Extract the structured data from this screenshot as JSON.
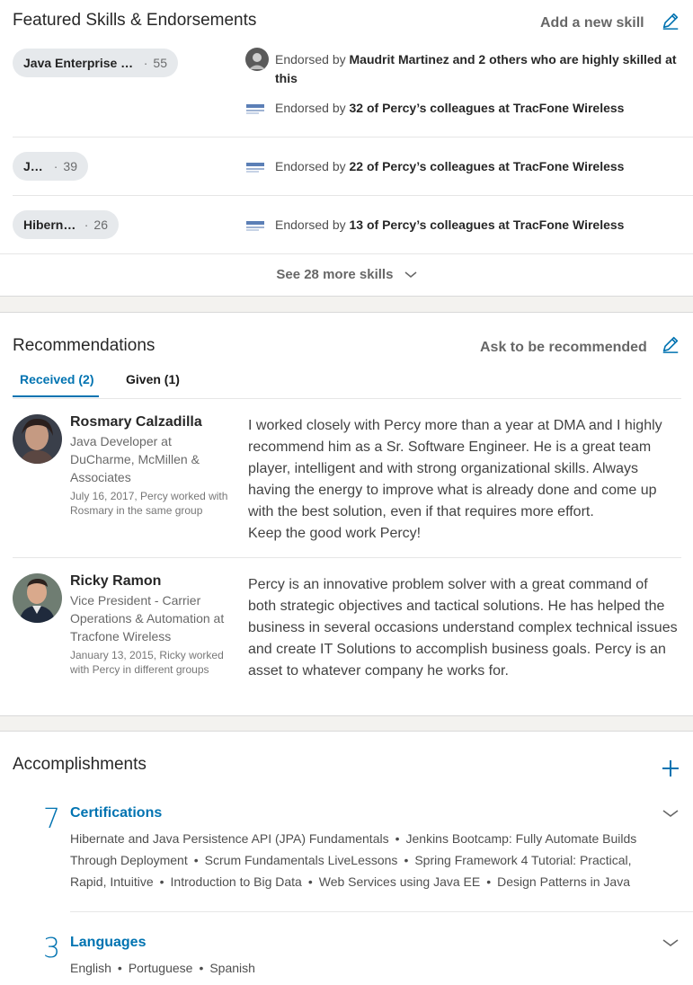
{
  "skills": {
    "title": "Featured Skills & Endorsements",
    "add_label": "Add a new skill",
    "items": [
      {
        "name": "Java Enterprise E…",
        "count": "55",
        "endorsements": [
          {
            "prefix": "Endorsed by ",
            "who": "Maudrit Martinez and 2 others who are highly skilled at this",
            "icon": "person-avatar"
          },
          {
            "prefix": "Endorsed by ",
            "who": "32 of Percy’s colleagues at TracFone Wireless",
            "icon": "company-logo"
          }
        ]
      },
      {
        "name": "Java",
        "count": "39",
        "endorsements": [
          {
            "prefix": "Endorsed by ",
            "who": "22 of Percy’s colleagues at TracFone Wireless",
            "icon": "company-logo"
          }
        ]
      },
      {
        "name": "Hibernate",
        "count": "26",
        "endorsements": [
          {
            "prefix": "Endorsed by ",
            "who": "13 of Percy’s colleagues at TracFone Wireless",
            "icon": "company-logo"
          }
        ]
      }
    ],
    "see_more": "See 28 more skills"
  },
  "recommendations": {
    "title": "Recommendations",
    "ask_label": "Ask to be recommended",
    "tabs": [
      {
        "label": "Received (2)",
        "active": true
      },
      {
        "label": "Given (1)",
        "active": false
      }
    ],
    "items": [
      {
        "name": "Rosmary Calzadilla",
        "role": "Java Developer at DuCharme, McMillen & Associates",
        "date": "July 16, 2017, Percy worked with Rosmary in the same group",
        "text": "I worked closely with Percy more than a year at DMA and I highly recommend him as a Sr. Software Engineer. He is a great team player, intelligent and with strong organizational skills. Always having the energy to improve what is already done and come up with the best solution, even if that requires more effort.",
        "text2": "Keep the good work Percy!"
      },
      {
        "name": "Ricky Ramon",
        "role": "Vice President - Carrier Operations & Automation at Tracfone Wireless",
        "date": "January 13, 2015, Ricky worked with Percy in different groups",
        "text": "Percy is an innovative problem solver with a great command of both strategic objectives and tactical solutions. He has helped the business in several occasions understand complex technical issues and create IT Solutions to accomplish business goals. Percy is an asset to whatever company he works for.",
        "text2": ""
      }
    ]
  },
  "accomplishments": {
    "title": "Accomplishments",
    "items": [
      {
        "count": "7",
        "title": "Certifications",
        "entries": [
          "Hibernate and Java Persistence API (JPA) Fundamentals",
          "Jenkins Bootcamp: Fully Automate Builds Through Deployment",
          "Scrum Fundamentals LiveLessons",
          "Spring Framework 4 Tutorial: Practical, Rapid, Intuitive",
          "Introduction to Big Data",
          "Web Services using Java EE",
          "Design Patterns in Java"
        ]
      },
      {
        "count": "3",
        "title": "Languages",
        "entries": [
          "English",
          "Portuguese",
          "Spanish"
        ]
      }
    ]
  },
  "colors": {
    "accent": "#0073b1",
    "pill_bg": "#e6e9ec"
  }
}
